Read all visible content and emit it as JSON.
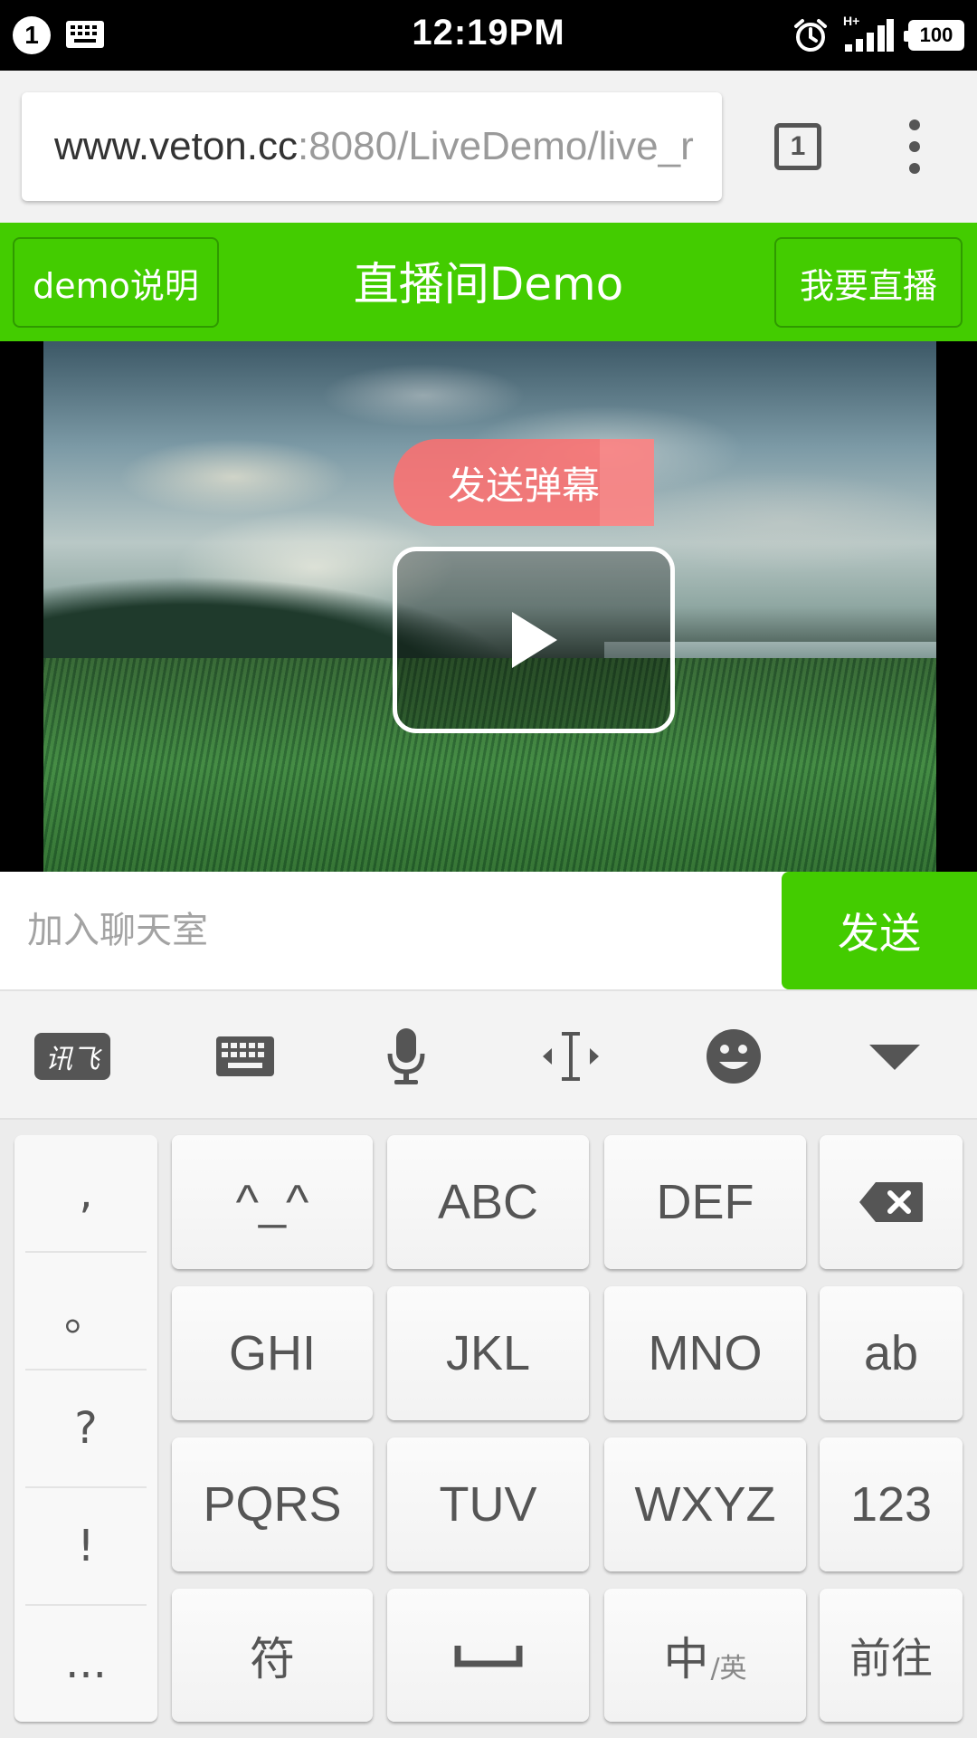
{
  "status_bar": {
    "notification_count": "1",
    "time": "12:19PM",
    "network": "H+",
    "battery": "100"
  },
  "browser": {
    "url_host": "www.veton.cc",
    "url_path": ":8080/LiveDemo/live_r",
    "tab_count": "1"
  },
  "header": {
    "left_button": "demo说明",
    "title": "直播间Demo",
    "right_button": "我要直播"
  },
  "video": {
    "danmu_button": "发送弹幕"
  },
  "chat": {
    "placeholder": "加入聊天室",
    "send_label": "发送"
  },
  "ime_toolbar": {
    "xunfei_label": "讯飞",
    "icons": [
      "xunfei-logo-icon",
      "keyboard-icon",
      "microphone-icon",
      "cursor-move-icon",
      "emoji-icon",
      "collapse-icon"
    ]
  },
  "keyboard": {
    "symbols": [
      ",",
      "。",
      "?",
      "!",
      "..."
    ],
    "row1": [
      "^_^",
      "ABC",
      "DEF"
    ],
    "row2": [
      "GHI",
      "JKL",
      "MNO",
      "ab"
    ],
    "row3": [
      "PQRS",
      "TUV",
      "WXYZ",
      "123"
    ],
    "row4": {
      "symbol": "符",
      "lang_main": "中",
      "lang_sub": "/英",
      "go": "前往"
    }
  },
  "colors": {
    "accent_green": "#43cc00",
    "danmu_red": "#ff6e6e"
  }
}
